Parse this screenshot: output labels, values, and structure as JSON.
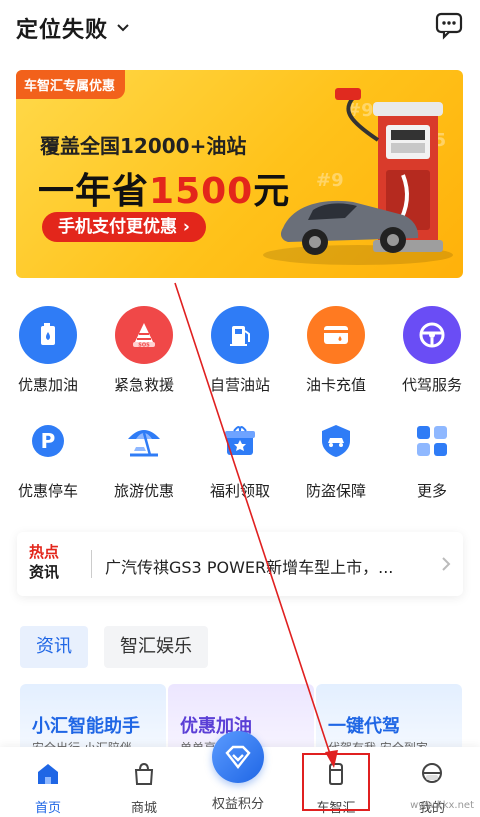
{
  "header": {
    "location": "定位失败",
    "message_icon": "chat-icon"
  },
  "banner": {
    "tag": "车智汇专属优惠",
    "line1": "覆盖全国12000+油站",
    "line2_prefix": "一年省",
    "line2_highlight": "1500",
    "line2_suffix": "元",
    "cta": "手机支付更优惠 ›",
    "colors": {
      "bg": "#ffc21a",
      "accent": "#e3261b",
      "tag": "#f2611b"
    }
  },
  "services": [
    {
      "label": "优惠加油",
      "icon": "fuel-can-icon",
      "color": "#2f7cf6"
    },
    {
      "label": "紧急救援",
      "icon": "sos-icon",
      "color": "#f04848"
    },
    {
      "label": "自营油站",
      "icon": "gas-pump-icon",
      "color": "#2f7cf6"
    },
    {
      "label": "油卡充值",
      "icon": "card-icon",
      "color": "#ff7a21"
    },
    {
      "label": "代驾服务",
      "icon": "steering-wheel-icon",
      "color": "#6a4df5"
    },
    {
      "label": "优惠停车",
      "icon": "parking-icon",
      "color": "#2f7cf6"
    },
    {
      "label": "旅游优惠",
      "icon": "beach-umbrella-icon",
      "color": "#2f7cf6"
    },
    {
      "label": "福利领取",
      "icon": "gift-icon",
      "color": "#2f7cf6"
    },
    {
      "label": "防盗保障",
      "icon": "shield-icon",
      "color": "#2f7cf6"
    },
    {
      "label": "更多",
      "icon": "grid-icon",
      "color": "#2f7cf6"
    }
  ],
  "news": {
    "badge_top": "热点",
    "badge_bottom": "资讯",
    "text": "广汽传祺GS3 POWER新增车型上市，..."
  },
  "tabs": [
    {
      "label": "资讯"
    },
    {
      "label": "智汇娱乐"
    }
  ],
  "cards": [
    {
      "title": "小汇智能助手",
      "subtitle": "安全出行 小汇陪伴"
    },
    {
      "title": "优惠加油",
      "subtitle": "单单享优惠"
    },
    {
      "title": "一键代驾",
      "subtitle": "代驾有我 安全到家"
    }
  ],
  "nav": [
    {
      "label": "首页",
      "icon": "home-icon"
    },
    {
      "label": "商城",
      "icon": "shopping-bag-icon"
    },
    {
      "label": "权益积分",
      "icon": "diamond-icon"
    },
    {
      "label": "车智汇",
      "icon": "cup-icon"
    },
    {
      "label": "我的",
      "icon": "avatar-icon"
    }
  ],
  "watermark": "www.kkx.net"
}
